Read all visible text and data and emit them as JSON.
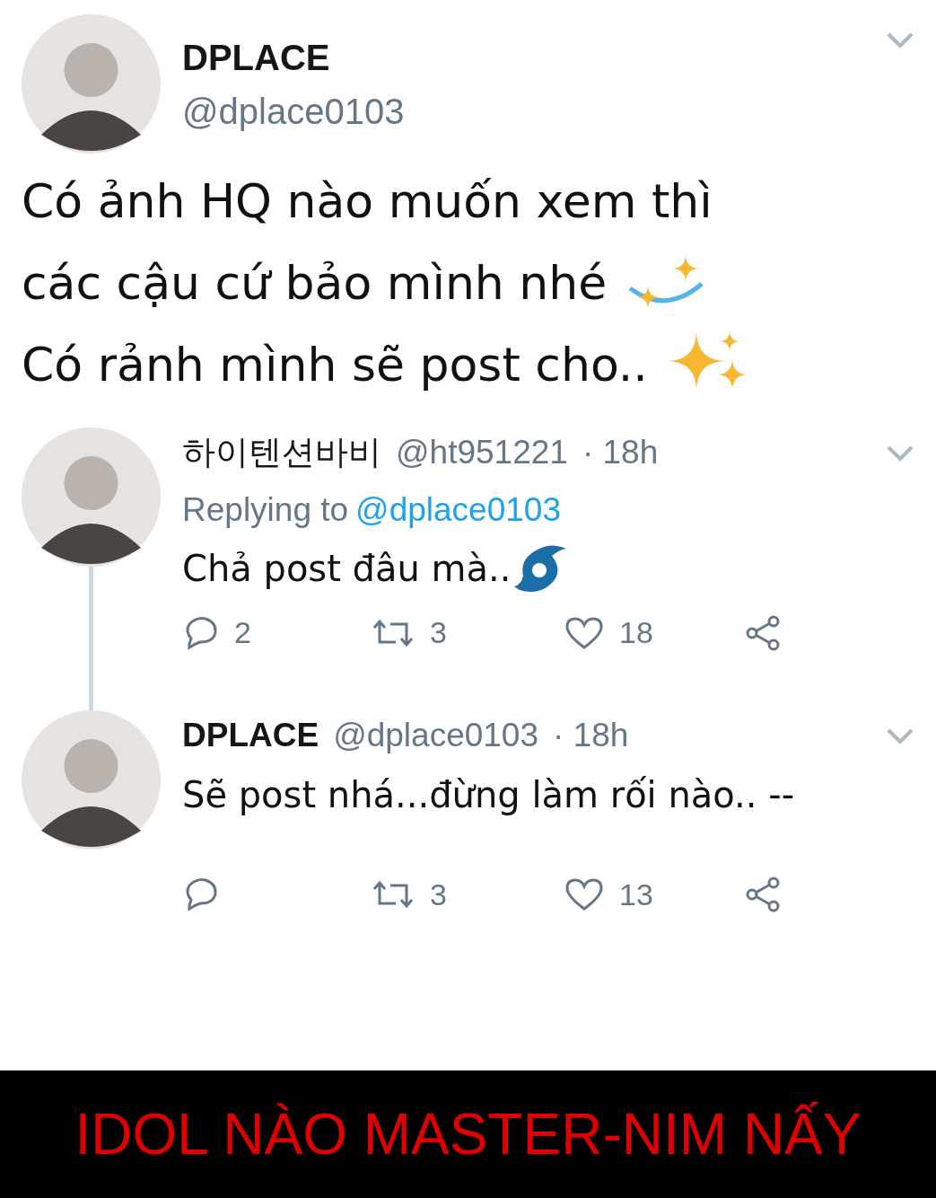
{
  "main_tweet": {
    "name": "DPLACE",
    "handle": "@dplace0103",
    "text_lines": [
      "Có ảnh HQ nào muốn xem thì",
      "các cậu cứ bảo mình nhé",
      "Có rảnh mình sẽ post cho.."
    ]
  },
  "replies": [
    {
      "name": "하이텐션바비",
      "handle": "@ht951221",
      "time": "· 18h",
      "replying_label": "Replying to",
      "replying_to": "@dplace0103",
      "text": "Chả post đâu mà..",
      "reply_count": "2",
      "retweet_count": "3",
      "like_count": "18",
      "thread_line": true
    },
    {
      "name": "DPLACE",
      "handle": "@dplace0103",
      "time": "· 18h",
      "text": "Sẽ post nhá...đừng làm rối nào.. --",
      "retweet_count": "3",
      "like_count": "13",
      "thread_line": false
    }
  ],
  "caption": "IDOL NÀO MASTER-NIM NẤY"
}
